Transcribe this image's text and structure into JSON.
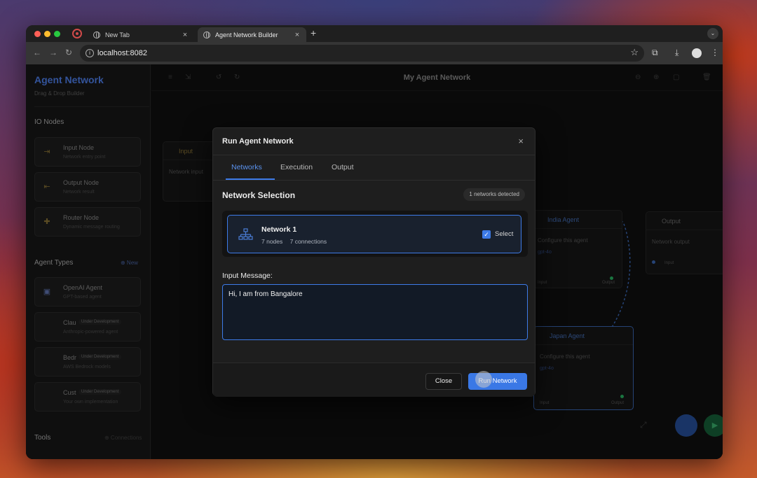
{
  "browser": {
    "tabs": [
      {
        "title": "New Tab"
      },
      {
        "title": "Agent Network Builder"
      }
    ],
    "url": "localhost:8082",
    "new_tab_symbol": "+",
    "close_symbol": "×"
  },
  "sidebar": {
    "brand_title": "Agent Network",
    "brand_subtitle": "Drag & Drop Builder",
    "io_section": "IO Nodes",
    "io_nodes": [
      {
        "title": "Input Node",
        "subtitle": "Network entry point",
        "icon": "login-icon"
      },
      {
        "title": "Output Node",
        "subtitle": "Network result",
        "icon": "logout-icon"
      },
      {
        "title": "Router Node",
        "subtitle": "Dynamic message routing",
        "icon": "router-icon"
      }
    ],
    "agent_section": "Agent Types",
    "agent_action": "⊕ New",
    "agents": [
      {
        "title": "OpenAI Agent",
        "subtitle": "GPT-based agent",
        "badge": ""
      },
      {
        "title": "Clau",
        "subtitle": "Anthropic-powered agent",
        "badge": "Under Development"
      },
      {
        "title": "Bedr",
        "subtitle": "AWS Bedrock models",
        "badge": "Under Development"
      },
      {
        "title": "Cust",
        "subtitle": "Your own implementation",
        "badge": "Under Development"
      }
    ],
    "tools_section": "Tools",
    "tools_action": "⊕ New",
    "tools_extra": "⊕ Connections"
  },
  "canvas": {
    "title": "My Agent Network",
    "nodes": {
      "input": {
        "title": "Input",
        "body": "Network input"
      },
      "india": {
        "title": "India Agent",
        "body": "Configure this agent",
        "sub": "gpt-4o",
        "in": "Input",
        "out": "Output"
      },
      "japan": {
        "title": "Japan Agent",
        "body": "Configure this agent",
        "sub": "gpt-4o",
        "in": "Input",
        "out": "Output"
      },
      "output": {
        "title": "Output",
        "body": "Network output",
        "in": "Input"
      }
    }
  },
  "modal": {
    "title": "Run Agent Network",
    "close_symbol": "×",
    "tabs": [
      "Networks",
      "Execution",
      "Output"
    ],
    "active_tab": "Networks",
    "section_title": "Network Selection",
    "detected_badge": "1 networks detected",
    "network": {
      "name": "Network 1",
      "nodes": "7 nodes",
      "connections": "7 connections",
      "checked": true,
      "select_label": "Select"
    },
    "input_label": "Input Message:",
    "input_value": "Hi, I am from Bangalore",
    "close_button": "Close",
    "run_button": "Run Network"
  },
  "colors": {
    "accent": "#3d7be8",
    "brand": "#3d63b8",
    "play": "#1f8a4c"
  }
}
